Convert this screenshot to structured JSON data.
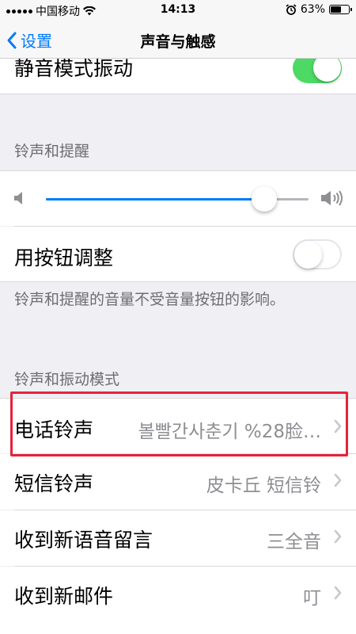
{
  "status_bar": {
    "carrier": "中国移动",
    "time": "14:13",
    "battery_text": "63%",
    "battery_level": 0.63
  },
  "nav": {
    "back_label": "设置",
    "title": "声音与触感"
  },
  "silent_vibrate": {
    "label": "静音模式振动",
    "on": true
  },
  "ringer_section": {
    "header": "铃声和提醒",
    "volume_level": 0.83,
    "change_with_buttons": {
      "label": "用按钮调整",
      "on": false
    },
    "footer": "铃声和提醒的音量不受音量按钮的影响。"
  },
  "patterns_section": {
    "header": "铃声和振动模式",
    "items": [
      {
        "label": "电话铃声",
        "value": "볼빨간사춘기 %28脸…"
      },
      {
        "label": "短信铃声",
        "value": "皮卡丘 短信铃"
      },
      {
        "label": "收到新语音留言",
        "value": "三全音"
      },
      {
        "label": "收到新邮件",
        "value": "叮"
      }
    ]
  },
  "colors": {
    "accent": "#007aff",
    "switch_on": "#4cd964",
    "highlight": "#e5233a"
  }
}
